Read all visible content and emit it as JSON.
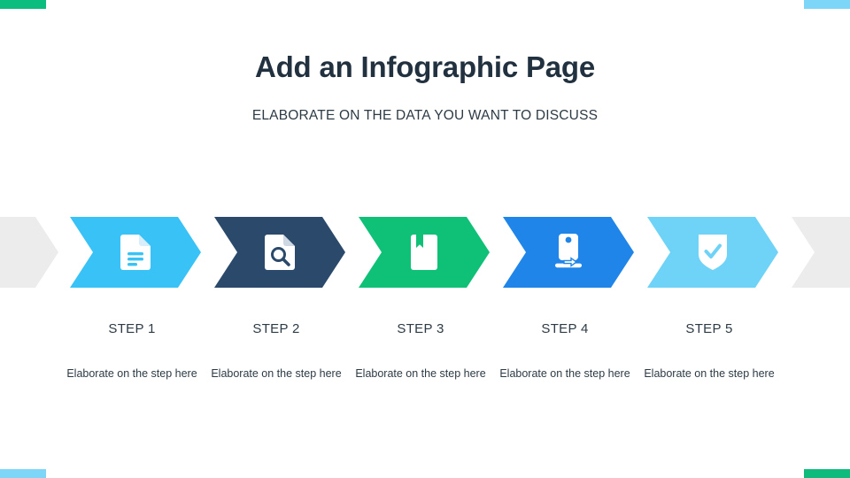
{
  "header": {
    "title": "Add an Infographic Page",
    "subtitle": "ELABORATE ON THE DATA YOU WANT TO DISCUSS"
  },
  "colors": {
    "sky_blue": "#38c2f5",
    "navy": "#2b4a6b",
    "green": "#0fc177",
    "blue": "#1f85e8",
    "light_blue": "#6fd3f7",
    "tail_gray": "#ececec",
    "text_dark": "#2d3b45",
    "title_dark": "#22313f",
    "background": "#ffffff"
  },
  "corner_bars": [
    {
      "name": "top-left",
      "color": "#0bbd7f"
    },
    {
      "name": "top-right",
      "color": "#7dd6f7"
    },
    {
      "name": "bottom-left",
      "color": "#7dd6f7"
    },
    {
      "name": "bottom-right",
      "color": "#0fbb7c"
    }
  ],
  "chevron_tails": [
    {
      "name": "left-tail",
      "color": "#ececec"
    },
    {
      "name": "right-tail",
      "color": "#ececec"
    }
  ],
  "steps": [
    {
      "title": "STEP 1",
      "description": "Elaborate on the step here",
      "color": "#38c2f5",
      "icon": "document-icon"
    },
    {
      "title": "STEP 2",
      "description": "Elaborate on the step here",
      "color": "#2b4a6b",
      "icon": "document-search-icon"
    },
    {
      "title": "STEP 3",
      "description": "Elaborate on the step here",
      "color": "#0fc177",
      "icon": "bookmark-book-icon"
    },
    {
      "title": "STEP 4",
      "description": "Elaborate on the step here",
      "color": "#1f85e8",
      "icon": "presentation-screen-icon"
    },
    {
      "title": "STEP 5",
      "description": "Elaborate on the step here",
      "color": "#6fd3f7",
      "icon": "shield-check-icon"
    }
  ]
}
